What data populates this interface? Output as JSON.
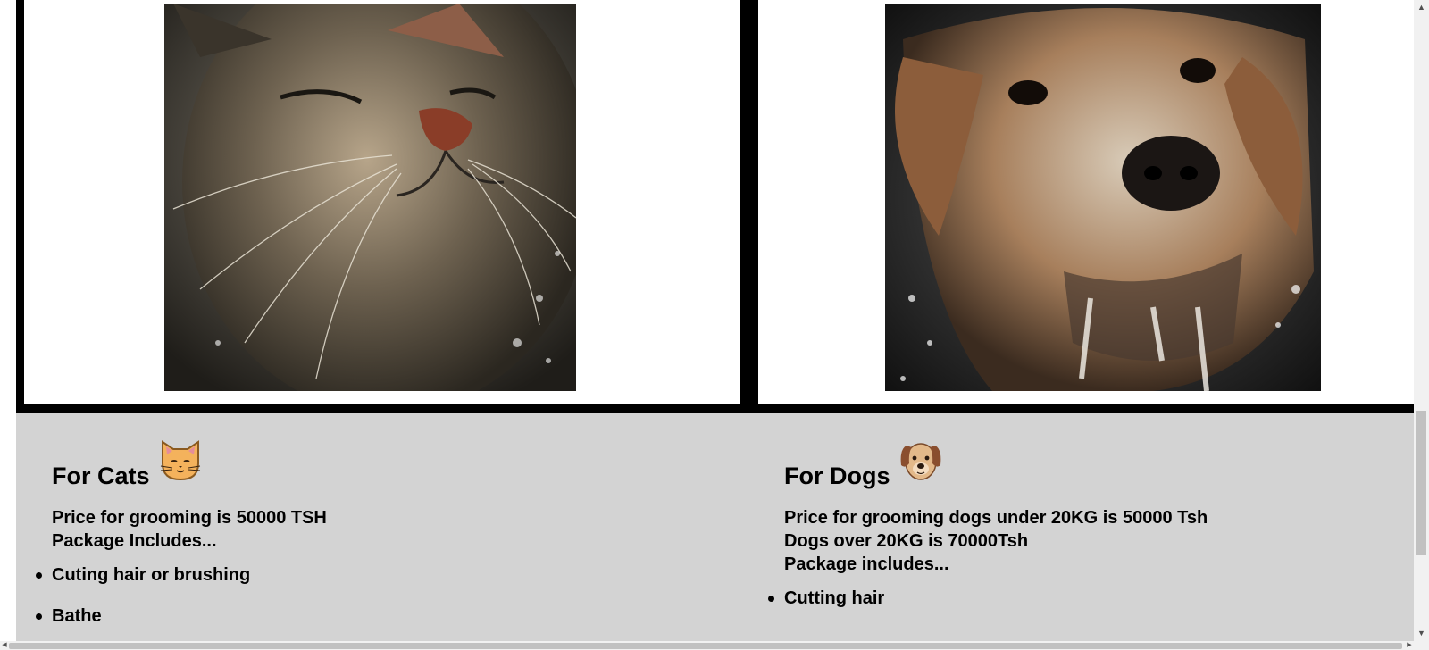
{
  "gallery": {
    "cat_image": "wet-cat-photo",
    "dog_image": "wet-dog-photo"
  },
  "cats": {
    "title": "For Cats",
    "emoji": "cat-face-emoji",
    "price": "Price for grooming is 50000 TSH",
    "package": "Package Includes...",
    "items": [
      "Cuting hair or brushing",
      "Bathe"
    ]
  },
  "dogs": {
    "title": "For Dogs",
    "emoji": "dog-face-emoji",
    "price_under": "Price for grooming dogs under 20KG is 50000 Tsh",
    "price_over": "Dogs over 20KG is 70000Tsh",
    "package": "Package includes...",
    "items": [
      "Cutting hair"
    ]
  },
  "colors": {
    "section_bg": "#d3d3d3",
    "frame": "#000000"
  }
}
